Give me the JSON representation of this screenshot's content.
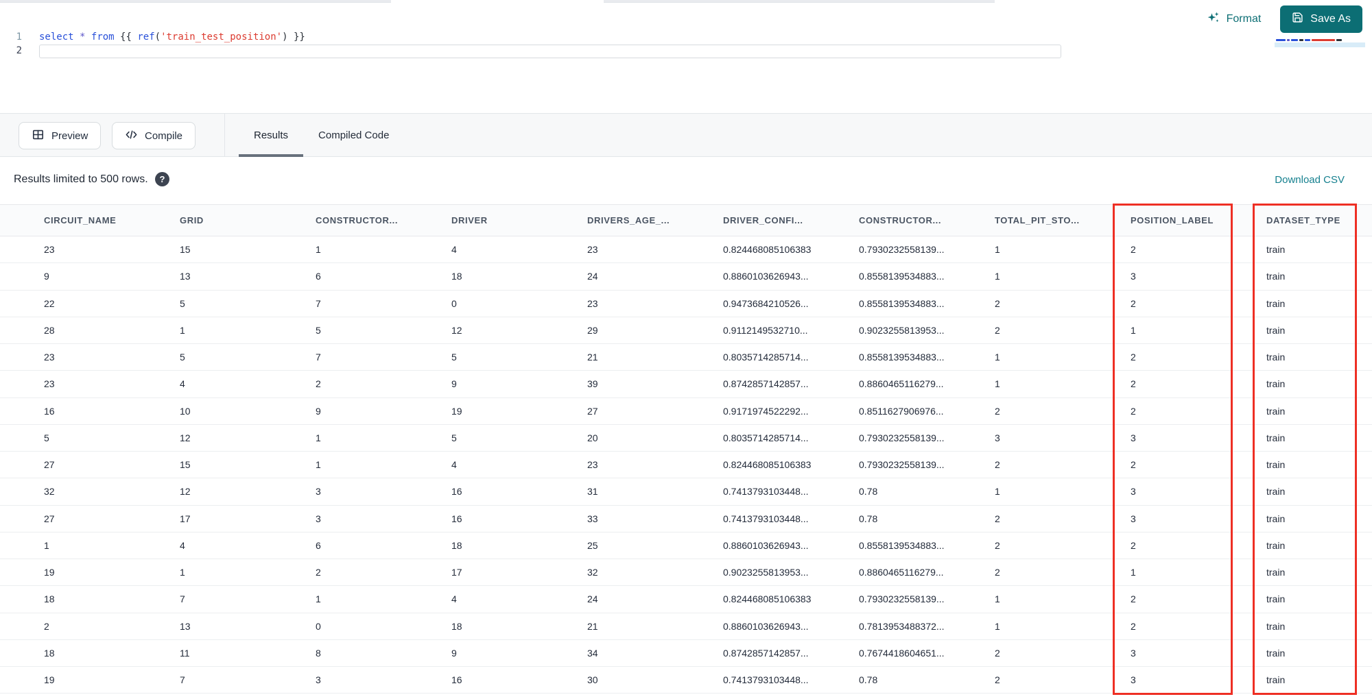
{
  "editor": {
    "line_numbers": [
      "1",
      "2"
    ],
    "active_line_index": 1,
    "code_tokens": [
      {
        "text": "select",
        "type": "kw"
      },
      {
        "text": " ",
        "type": "pl"
      },
      {
        "text": "*",
        "type": "op"
      },
      {
        "text": " ",
        "type": "pl"
      },
      {
        "text": "from",
        "type": "kw"
      },
      {
        "text": " ",
        "type": "pl"
      },
      {
        "text": "{{ ",
        "type": "br"
      },
      {
        "text": "ref",
        "type": "fn"
      },
      {
        "text": "(",
        "type": "br"
      },
      {
        "text": "'train_test_position'",
        "type": "str"
      },
      {
        "text": ") ",
        "type": "br"
      },
      {
        "text": "}}",
        "type": "br"
      }
    ],
    "format_label": "Format",
    "save_as_label": "Save As"
  },
  "toolbar": {
    "preview_label": "Preview",
    "compile_label": "Compile",
    "tabs": [
      {
        "label": "Results",
        "active": true
      },
      {
        "label": "Compiled Code",
        "active": false
      }
    ]
  },
  "results_bar": {
    "limit_text": "Results limited to 500 rows.",
    "help_icon": "?",
    "download_label": "Download CSV"
  },
  "table": {
    "columns": [
      "CIRCUIT_NAME",
      "GRID",
      "CONSTRUCTOR...",
      "DRIVER",
      "DRIVERS_AGE_...",
      "DRIVER_CONFI...",
      "CONSTRUCTOR...",
      "TOTAL_PIT_STO...",
      "POSITION_LABEL",
      "DATASET_TYPE"
    ],
    "rows": [
      [
        "23",
        "15",
        "1",
        "4",
        "23",
        "0.824468085106383",
        "0.7930232558139...",
        "1",
        "2",
        "train"
      ],
      [
        "9",
        "13",
        "6",
        "18",
        "24",
        "0.8860103626943...",
        "0.8558139534883...",
        "1",
        "3",
        "train"
      ],
      [
        "22",
        "5",
        "7",
        "0",
        "23",
        "0.9473684210526...",
        "0.8558139534883...",
        "2",
        "2",
        "train"
      ],
      [
        "28",
        "1",
        "5",
        "12",
        "29",
        "0.9112149532710...",
        "0.9023255813953...",
        "2",
        "1",
        "train"
      ],
      [
        "23",
        "5",
        "7",
        "5",
        "21",
        "0.8035714285714...",
        "0.8558139534883...",
        "1",
        "2",
        "train"
      ],
      [
        "23",
        "4",
        "2",
        "9",
        "39",
        "0.8742857142857...",
        "0.8860465116279...",
        "1",
        "2",
        "train"
      ],
      [
        "16",
        "10",
        "9",
        "19",
        "27",
        "0.9171974522292...",
        "0.8511627906976...",
        "2",
        "2",
        "train"
      ],
      [
        "5",
        "12",
        "1",
        "5",
        "20",
        "0.8035714285714...",
        "0.7930232558139...",
        "3",
        "3",
        "train"
      ],
      [
        "27",
        "15",
        "1",
        "4",
        "23",
        "0.824468085106383",
        "0.7930232558139...",
        "2",
        "2",
        "train"
      ],
      [
        "32",
        "12",
        "3",
        "16",
        "31",
        "0.7413793103448...",
        "0.78",
        "1",
        "3",
        "train"
      ],
      [
        "27",
        "17",
        "3",
        "16",
        "33",
        "0.7413793103448...",
        "0.78",
        "2",
        "3",
        "train"
      ],
      [
        "1",
        "4",
        "6",
        "18",
        "25",
        "0.8860103626943...",
        "0.8558139534883...",
        "2",
        "2",
        "train"
      ],
      [
        "19",
        "1",
        "2",
        "17",
        "32",
        "0.9023255813953...",
        "0.8860465116279...",
        "2",
        "1",
        "train"
      ],
      [
        "18",
        "7",
        "1",
        "4",
        "24",
        "0.824468085106383",
        "0.7930232558139...",
        "1",
        "2",
        "train"
      ],
      [
        "2",
        "13",
        "0",
        "18",
        "21",
        "0.8860103626943...",
        "0.7813953488372...",
        "1",
        "2",
        "train"
      ],
      [
        "18",
        "11",
        "8",
        "9",
        "34",
        "0.8742857142857...",
        "0.7674418604651...",
        "2",
        "3",
        "train"
      ],
      [
        "19",
        "7",
        "3",
        "16",
        "30",
        "0.7413793103448...",
        "0.78",
        "2",
        "3",
        "train"
      ]
    ],
    "highlighted_columns": [
      "POSITION_LABEL",
      "DATASET_TYPE"
    ]
  },
  "colors": {
    "accent_teal": "#0c6e74",
    "link_teal": "#16808f",
    "highlight_red": "#ee2f24",
    "toolbar_bg": "#f7f8f9",
    "keyword_blue": "#2950d9",
    "string_red": "#dc3b30"
  }
}
